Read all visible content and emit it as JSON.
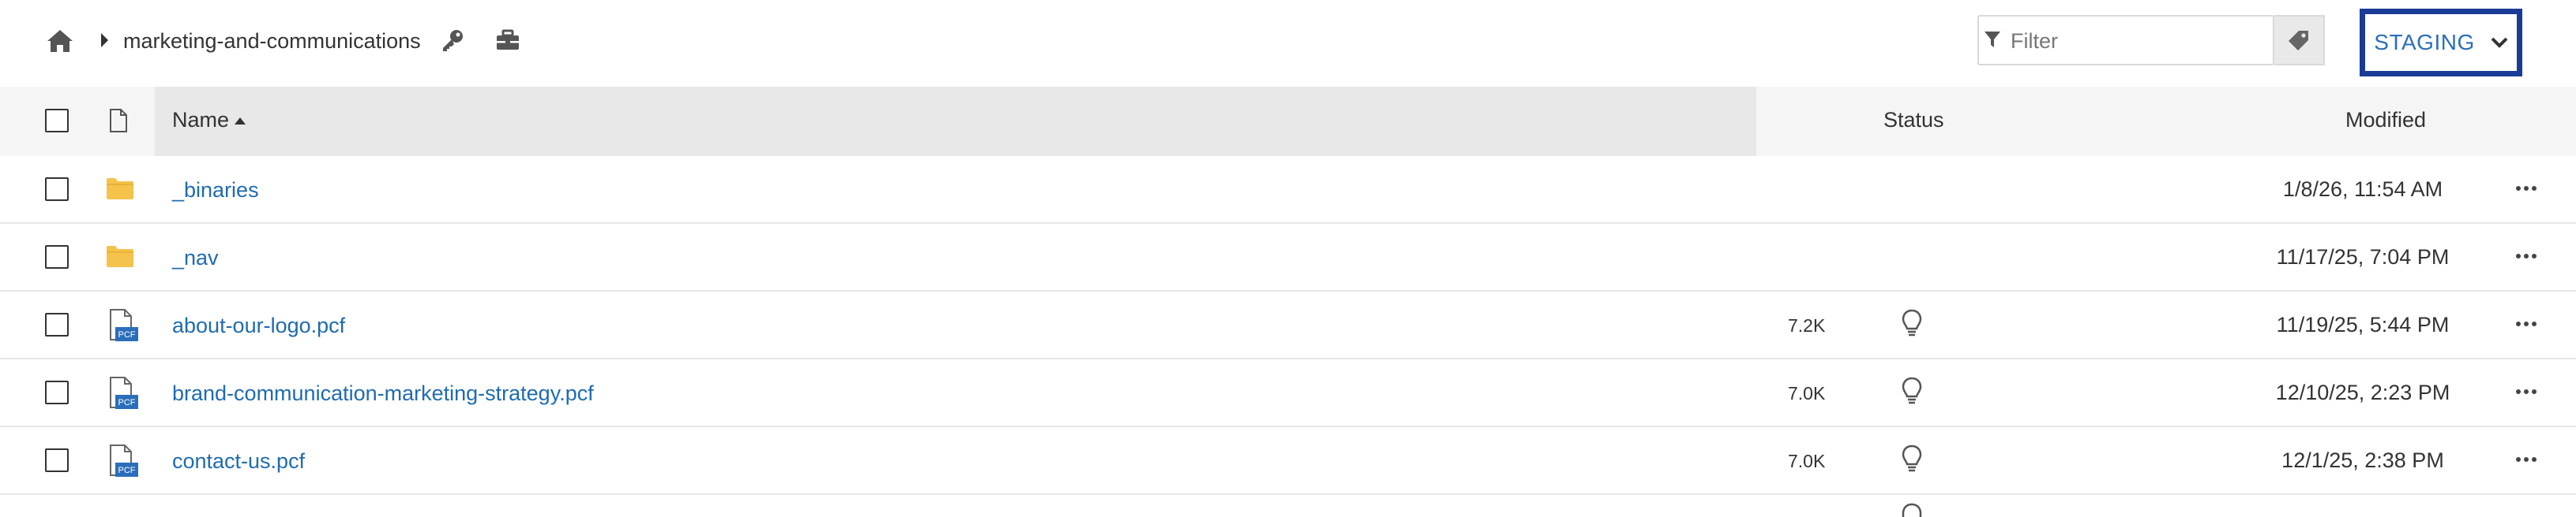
{
  "breadcrumb": {
    "home_icon": "home-icon",
    "separator_icon": "caret-right-icon",
    "folder": "marketing-and-communications",
    "key_icon": "key-icon",
    "toolbox_icon": "toolbox-icon"
  },
  "filter": {
    "placeholder": "Filter",
    "value": "",
    "filter_icon": "filter-icon",
    "tag_icon": "tag-icon"
  },
  "environment": {
    "label": "STAGING",
    "icon": "chevron-down-icon",
    "border_color": "#1a3c96",
    "text_color": "#2a6ebb"
  },
  "table": {
    "columns": {
      "name": "Name",
      "status": "Status",
      "modified": "Modified"
    },
    "sort": {
      "column": "Name",
      "direction": "ascending"
    },
    "rows": [
      {
        "type": "folder",
        "name": "_binaries",
        "size": "",
        "status_icon": "",
        "modified": "1/8/26, 11:54 AM"
      },
      {
        "type": "folder",
        "name": "_nav",
        "size": "",
        "status_icon": "",
        "modified": "11/17/25, 7:04 PM"
      },
      {
        "type": "pcf",
        "badge": "PCF",
        "name": "about-our-logo.pcf",
        "size": "7.2K",
        "status_icon": "lightbulb-icon",
        "modified": "11/19/25, 5:44 PM"
      },
      {
        "type": "pcf",
        "badge": "PCF",
        "name": "brand-communication-marketing-strategy.pcf",
        "size": "7.0K",
        "status_icon": "lightbulb-icon",
        "modified": "12/10/25, 2:23 PM"
      },
      {
        "type": "pcf",
        "badge": "PCF",
        "name": "contact-us.pcf",
        "size": "7.0K",
        "status_icon": "lightbulb-icon",
        "modified": "12/1/25, 2:38 PM"
      }
    ]
  },
  "colors": {
    "link": "#1f6bb0",
    "folder": "#f5c24c",
    "pcf_badge": "#2a6ebb",
    "header_bg": "#f5f5f5",
    "sorted_header_bg": "#e8e8e8"
  }
}
